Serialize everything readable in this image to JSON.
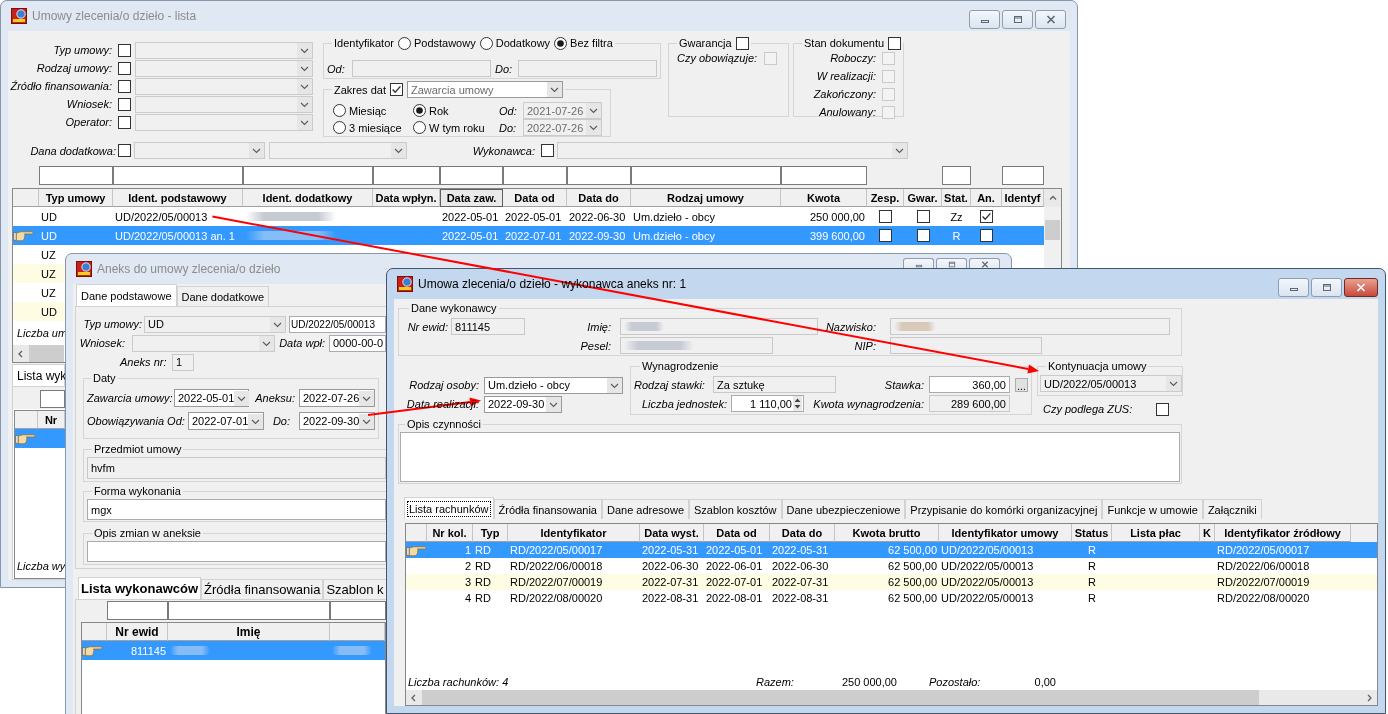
{
  "list_window": {
    "title": "Umowy zlecenia/o dzieło - lista",
    "active": false,
    "filters": [
      {
        "label": "Typ umowy:",
        "checked": false
      },
      {
        "label": "Rodzaj umowy:",
        "checked": false
      },
      {
        "label": "Źródło finansowania:",
        "checked": false
      },
      {
        "label": "Wniosek:",
        "checked": false
      },
      {
        "label": "Operator:",
        "checked": false
      }
    ],
    "identifier": {
      "label": "Identyfikator",
      "options": [
        {
          "label": "Podstawowy",
          "selected": false
        },
        {
          "label": "Dodatkowy",
          "selected": false
        },
        {
          "label": "Bez filtra",
          "selected": true
        }
      ],
      "from_label": "Od:",
      "to_label": "Do:"
    },
    "date_range": {
      "label": "Zakres dat",
      "checked": true,
      "field": "Zawarcia umowy",
      "options": [
        {
          "label": "Miesiąc",
          "selected": false
        },
        {
          "label": "Rok",
          "selected": true
        },
        {
          "label": "3 miesiące",
          "selected": false
        },
        {
          "label": "W tym roku",
          "selected": false
        }
      ],
      "from_label": "Od:",
      "from": "2021-07-26",
      "to_label": "Do:",
      "to": "2022-07-26"
    },
    "guarantee": {
      "label": "Gwarancja",
      "checked": false,
      "items": [
        {
          "label": "Czy obowiązuje:",
          "checked": false,
          "disabled": true
        }
      ]
    },
    "document_state": {
      "label": "Stan dokumentu",
      "checked": false,
      "items": [
        {
          "label": "Roboczy:",
          "checked": false,
          "disabled": true
        },
        {
          "label": "W realizacji:",
          "checked": false,
          "disabled": true
        },
        {
          "label": "Zakończony:",
          "checked": false,
          "disabled": true
        },
        {
          "label": "Anulowany:",
          "checked": false,
          "disabled": true
        }
      ]
    },
    "extra_data": {
      "label": "Dana dodatkowa:",
      "checked": false
    },
    "contractor": {
      "label": "Wykonawca:",
      "checked": false
    },
    "table": {
      "columns": [
        {
          "label": "Typ umowy",
          "kind": "text",
          "filter": true,
          "sorted": false
        },
        {
          "label": "Ident. podstawowy",
          "kind": "text",
          "filter": true,
          "sorted": false
        },
        {
          "label": "Ident. dodatkowy",
          "kind": "text",
          "filter": true,
          "sorted": false
        },
        {
          "label": "Data wpłyn.",
          "kind": "text",
          "filter": true,
          "sorted": false
        },
        {
          "label": "Data zaw.",
          "kind": "text",
          "filter": true,
          "sorted": true
        },
        {
          "label": "Data od",
          "kind": "text",
          "filter": true,
          "sorted": false
        },
        {
          "label": "Data do",
          "kind": "text",
          "filter": true,
          "sorted": false
        },
        {
          "label": "Rodzaj umowy",
          "kind": "text",
          "filter": true,
          "sorted": false
        },
        {
          "label": "Kwota",
          "kind": "amount",
          "filter": true,
          "sorted": false
        },
        {
          "label": "Zesp.",
          "kind": "check",
          "filter": false,
          "sorted": false
        },
        {
          "label": "Gwar.",
          "kind": "check",
          "filter": false,
          "sorted": false
        },
        {
          "label": "Stat.",
          "kind": "status",
          "filter": true,
          "sorted": false
        },
        {
          "label": "An.",
          "kind": "check",
          "filter": false,
          "sorted": false
        },
        {
          "label": "Identyf",
          "kind": "text",
          "filter": true,
          "sorted": false
        }
      ],
      "rows": [
        {
          "selected": false,
          "highlighted": false,
          "cells": [
            "UD",
            "UD/2022/05/00013",
            {
              "redacted": true
            },
            "",
            "2022-05-01",
            "2022-05-01",
            "2022-06-30",
            "Um.dzieło - obcy",
            "250 000,00",
            {
              "checked": false
            },
            {
              "checked": false
            },
            "Zz",
            {
              "checked": true
            },
            ""
          ]
        },
        {
          "selected": true,
          "cells": [
            "UD",
            "UD/2022/05/00013 an. 1",
            {
              "redacted": true
            },
            "",
            "2022-05-01",
            "2022-07-01",
            "2022-09-30",
            "Um.dzieło - obcy",
            "399 600,00",
            {
              "checked": false
            },
            {
              "checked": false
            },
            "R",
            {
              "checked": false
            },
            ""
          ]
        },
        {
          "selected": false,
          "highlighted": false,
          "cells": [
            "UZ"
          ]
        },
        {
          "selected": false,
          "highlighted": true,
          "cells": [
            "UZ"
          ]
        },
        {
          "selected": false,
          "highlighted": false,
          "cells": [
            "UZ"
          ]
        },
        {
          "selected": false,
          "highlighted": true,
          "cells": [
            "UD"
          ]
        }
      ],
      "footer": "Liczba um"
    },
    "bottom_tabs": [
      {
        "label": "Lista wyk",
        "selected": true
      }
    ],
    "bottom_table": {
      "columns": [
        {
          "label": "Nr",
          "filter": true
        }
      ],
      "rows": [
        {
          "selected": true
        }
      ],
      "footer": "Liczba wy"
    }
  },
  "annex_window": {
    "title": "Aneks do umowy zlecenia/o dzieło",
    "active": false,
    "tabs": [
      {
        "label": "Dane podstawowe",
        "selected": true
      },
      {
        "label": "Dane dodatkowe",
        "selected": false
      }
    ],
    "contract_type": {
      "label": "Typ umowy:",
      "value": "UD",
      "readonly": true
    },
    "contract_number": {
      "value": "UD/2022/05/00013",
      "readonly": false
    },
    "request": {
      "label": "Wniosek:",
      "readonly": true
    },
    "entry_date": {
      "label": "Data wpł:",
      "value": "0000-00-0",
      "readonly": false
    },
    "annex_number": {
      "label": "Aneks nr:",
      "value": "1",
      "readonly": true
    },
    "dates": {
      "label": "Daty",
      "fields": [
        {
          "label": "Zawarcia umowy:",
          "value": "2022-05-01"
        },
        {
          "label": "Aneksu:",
          "value": "2022-07-26"
        },
        {
          "label": "Obowiązywania Od:",
          "value": "2022-07-01"
        },
        {
          "label": "Do:",
          "value": "2022-09-30"
        }
      ]
    },
    "subject": {
      "label": "Przedmiot umowy",
      "value": "hvfm",
      "readonly": true
    },
    "execution_form": {
      "label": "Forma wykonania",
      "value": "mgx",
      "readonly": false
    },
    "change_description": {
      "label": "Opis zmian w aneksie",
      "readonly": false
    },
    "bottom_tabs": [
      {
        "label": "Lista wykonawców",
        "selected": true
      },
      {
        "label": "Źródła finansowania",
        "selected": false
      },
      {
        "label": "Szablon k",
        "selected": false
      }
    ],
    "table": {
      "columns": [
        {
          "label": "Nr ewid",
          "kind": "amount",
          "filter": true
        },
        {
          "label": "Imię",
          "kind": "text",
          "filter": true
        },
        {
          "kind": "text",
          "filter": true
        }
      ],
      "rows": [
        {
          "selected": true,
          "cells": [
            "811145",
            {
              "redacted": true
            },
            {
              "redacted": true
            }
          ]
        }
      ]
    }
  },
  "contractor_window": {
    "title": "Umowa zlecenia/o dzieło - wykonawca aneks nr: 1",
    "active": true,
    "person": {
      "label": "Dane wykonawcy",
      "fields": [
        {
          "label": "Nr ewid:",
          "value": "811145",
          "readonly": true
        },
        {
          "label": "Imię:",
          "redacted": true,
          "readonly": true
        },
        {
          "label": "Nazwisko:",
          "redacted": true,
          "readonly": true
        },
        {
          "label": "Pesel:",
          "redacted": true,
          "readonly": true
        },
        {
          "label": "NIP:",
          "readonly": true
        }
      ]
    },
    "person_type": {
      "label": "Rodzaj osoby:",
      "value": "Um.dzieło - obcy",
      "readonly": false
    },
    "completion_date": {
      "label": "Data realizacji:",
      "value": "2022-09-30",
      "readonly": false
    },
    "pay": {
      "label": "Wynagrodzenie",
      "rate_type": {
        "label": "Rodzaj stawki:",
        "value": "Za sztukę",
        "readonly": true
      },
      "rate": {
        "label": "Stawka:",
        "value": "360,00",
        "readonly": false
      },
      "more_button": "...",
      "units": {
        "label": "Liczba jednostek:",
        "value": "1 110,00",
        "readonly": false
      },
      "amount": {
        "label": "Kwota wynagrodzenia:",
        "value": "289 600,00",
        "readonly": true
      }
    },
    "continuation": {
      "label": "Kontynuacja umowy",
      "value": "UD/2022/05/00013",
      "readonly": true
    },
    "zus": {
      "label": "Czy podlega ZUS:",
      "checked": false
    },
    "description": {
      "label": "Opis czynności",
      "readonly": false
    },
    "tabs": [
      {
        "label": "Lista rachunków",
        "selected": true
      },
      {
        "label": "Źródła finansowania",
        "selected": false
      },
      {
        "label": "Dane adresowe",
        "selected": false
      },
      {
        "label": "Szablon kosztów",
        "selected": false
      },
      {
        "label": "Dane ubezpieczeniowe",
        "selected": false
      },
      {
        "label": "Przypisanie do komórki organizacyjnej",
        "selected": false
      },
      {
        "label": "Funkcje w umowie",
        "selected": false
      },
      {
        "label": "Załączniki",
        "selected": false
      }
    ],
    "table": {
      "columns": [
        {
          "label": "Nr kol.",
          "kind": "amount"
        },
        {
          "label": "Typ",
          "kind": "text"
        },
        {
          "label": "Identyfikator",
          "kind": "text"
        },
        {
          "label": "Data wyst.",
          "kind": "text"
        },
        {
          "label": "Data od",
          "kind": "text"
        },
        {
          "label": "Data do",
          "kind": "text"
        },
        {
          "label": "Kwota brutto",
          "kind": "amount"
        },
        {
          "label": "Identyfikator umowy",
          "kind": "text"
        },
        {
          "label": "Status",
          "kind": "status"
        },
        {
          "label": "Lista płac",
          "kind": "text"
        },
        {
          "label": "K",
          "kind": "text"
        },
        {
          "label": "Identyfikator źródłowy",
          "kind": "text"
        }
      ],
      "rows": [
        {
          "selected": true,
          "cells": [
            "1",
            "RD",
            "RD/2022/05/00017",
            "2022-05-31",
            "2022-05-01",
            "2022-05-31",
            "62 500,00",
            "UD/2022/05/00013",
            "R",
            "",
            "",
            "RD/2022/05/00017"
          ]
        },
        {
          "selected": false,
          "highlighted": false,
          "cells": [
            "2",
            "RD",
            "RD/2022/06/00018",
            "2022-06-30",
            "2022-06-01",
            "2022-06-30",
            "62 500,00",
            "UD/2022/05/00013",
            "R",
            "",
            "",
            "RD/2022/06/00018"
          ]
        },
        {
          "selected": false,
          "highlighted": true,
          "cells": [
            "3",
            "RD",
            "RD/2022/07/00019",
            "2022-07-31",
            "2022-07-01",
            "2022-07-31",
            "62 500,00",
            "UD/2022/05/00013",
            "R",
            "",
            "",
            "RD/2022/07/00019"
          ]
        },
        {
          "selected": false,
          "highlighted": false,
          "cells": [
            "4",
            "RD",
            "RD/2022/08/00020",
            "2022-08-31",
            "2022-08-01",
            "2022-08-31",
            "62 500,00",
            "UD/2022/05/00013",
            "R",
            "",
            "",
            "RD/2022/08/00020"
          ]
        }
      ]
    },
    "summary": {
      "count": "Liczba rachunków: 4",
      "total_label": "Razem:",
      "total": "250 000,00",
      "remaining_label": "Pozostało:",
      "remaining": "0,00"
    }
  },
  "annotations": [
    {
      "kind": "arrow"
    },
    {
      "kind": "arrow"
    }
  ]
}
